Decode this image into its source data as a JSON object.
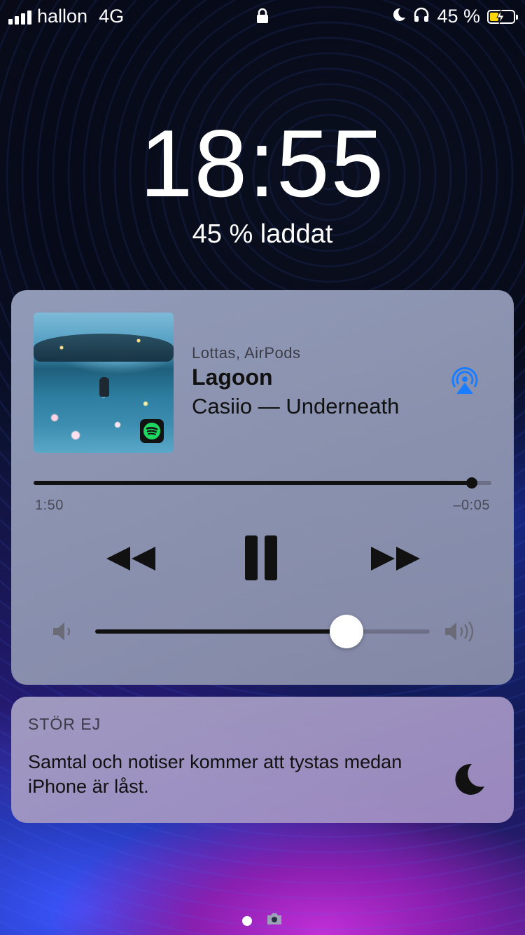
{
  "status_bar": {
    "carrier": "hallon",
    "network": "4G",
    "battery_percent": "45 %",
    "battery_level": 0.45,
    "icons": [
      "signal-icon",
      "lock-icon",
      "moon-icon",
      "headphones-icon",
      "battery-charging-icon"
    ]
  },
  "lockscreen": {
    "time": "18:55",
    "charging_text": "45 % laddat"
  },
  "now_playing": {
    "device": "Lottas, AirPods",
    "title": "Lagoon",
    "artist_album": "Casiio — Underneath",
    "elapsed": "1:50",
    "remaining": "–0:05",
    "progress": 0.957,
    "volume": 0.75,
    "app_badge": "spotify-icon",
    "accent_color": "#1a7cff"
  },
  "dnd": {
    "heading": "STÖR EJ",
    "message": "Samtal och notiser kommer att tystas medan iPhone är låst."
  }
}
